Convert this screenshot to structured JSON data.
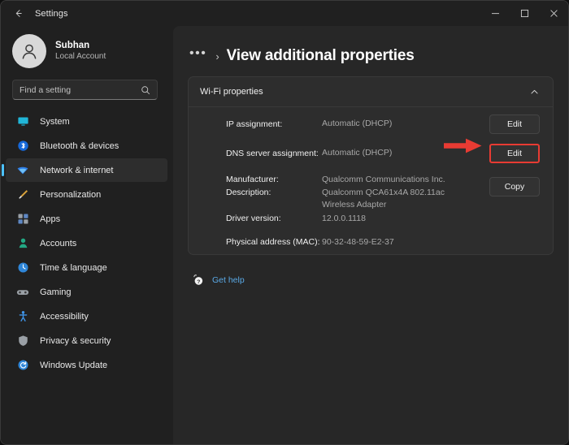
{
  "window": {
    "title": "Settings",
    "back_icon": "arrow-left-icon",
    "controls": {
      "minimize": "minimize-icon",
      "maximize": "maximize-icon",
      "close": "close-icon"
    }
  },
  "sidebar": {
    "account": {
      "name": "Subhan",
      "subtitle": "Local Account",
      "avatar_icon": "person-avatar-icon"
    },
    "search": {
      "placeholder": "Find a setting",
      "icon": "search-icon"
    },
    "items": [
      {
        "label": "System",
        "icon": "monitor-icon",
        "selected": false
      },
      {
        "label": "Bluetooth & devices",
        "icon": "bluetooth-icon",
        "selected": false
      },
      {
        "label": "Network & internet",
        "icon": "wifi-icon",
        "selected": true
      },
      {
        "label": "Personalization",
        "icon": "paintbrush-icon",
        "selected": false
      },
      {
        "label": "Apps",
        "icon": "apps-grid-icon",
        "selected": false
      },
      {
        "label": "Accounts",
        "icon": "account-person-icon",
        "selected": false
      },
      {
        "label": "Time & language",
        "icon": "clock-icon",
        "selected": false
      },
      {
        "label": "Gaming",
        "icon": "gamepad-icon",
        "selected": false
      },
      {
        "label": "Accessibility",
        "icon": "accessibility-icon",
        "selected": false
      },
      {
        "label": "Privacy & security",
        "icon": "shield-icon",
        "selected": false
      },
      {
        "label": "Windows Update",
        "icon": "update-refresh-icon",
        "selected": false
      }
    ]
  },
  "main": {
    "breadcrumb": {
      "overflow": "•••",
      "separator": "›"
    },
    "page_title": "View additional properties",
    "card": {
      "header": "Wi-Fi properties",
      "expand_icon": "chevron-up-icon",
      "rows": [
        {
          "label": "IP assignment:",
          "value": "Automatic (DHCP)",
          "button": "Edit",
          "highlighted": false
        },
        {
          "label": "DNS server assignment:",
          "value": "Automatic (DHCP)",
          "button": "Edit",
          "highlighted": true
        }
      ],
      "details": {
        "manufacturer_label": "Manufacturer:",
        "manufacturer_value": "Qualcomm Communications Inc.",
        "description_label": "Description:",
        "description_value": "Qualcomm QCA61x4A 802.11ac Wireless Adapter",
        "driver_label": "Driver version:",
        "driver_value": "12.0.0.1118",
        "mac_label": "Physical address (MAC):",
        "mac_value": "90-32-48-59-E2-37",
        "copy_button": "Copy"
      }
    },
    "get_help": {
      "label": "Get help",
      "icon": "help-question-icon"
    }
  },
  "annotation": {
    "arrow_icon": "red-arrow-right-icon",
    "arrow_color": "#e83b33",
    "highlight_color": "#e83b33",
    "target": "Edit"
  },
  "colors": {
    "accent": "#4cc2ff",
    "window_bg": "#202020",
    "content_bg": "#272727",
    "card_bg": "#2d2d2d",
    "link": "#5aa9e6"
  }
}
